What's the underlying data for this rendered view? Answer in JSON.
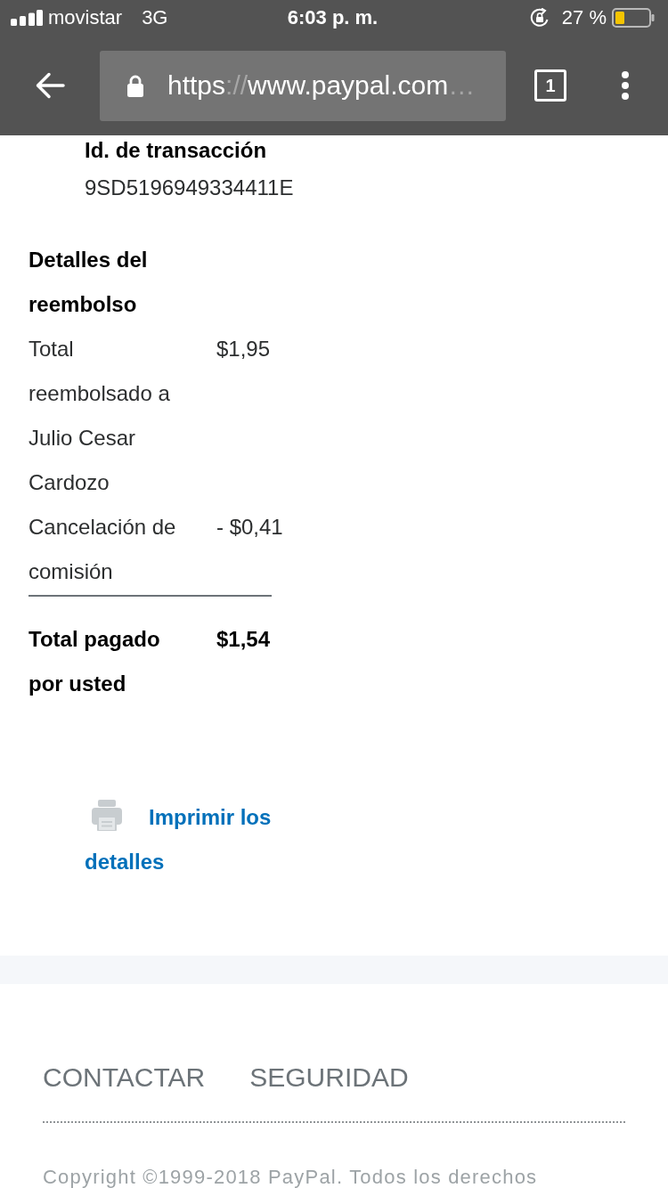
{
  "status_bar": {
    "carrier": "movistar",
    "network": "3G",
    "time": "6:03 p. m.",
    "battery": "27 %"
  },
  "browser": {
    "url": {
      "scheme": "https",
      "separator": "://",
      "host": "www.paypal.com",
      "ellipsis": "…"
    },
    "tab_count": "1"
  },
  "transaction": {
    "label": "Id. de transacción",
    "id": "9SD5196949334411E"
  },
  "refund_details": {
    "title": "Detalles del reembolso",
    "rows": [
      {
        "label": "Total reembolsado a Julio Cesar Cardozo",
        "amount": "$1,95"
      },
      {
        "label": "Cancelación de comisión",
        "amount": "- $0,41"
      }
    ],
    "total": {
      "label": "Total pagado por usted",
      "amount": "$1,54"
    }
  },
  "print_link": "Imprimir los detalles",
  "footer": {
    "links": [
      "CONTACTAR",
      "SEGURIDAD"
    ],
    "copyright": "Copyright ©1999-2018 PayPal. Todos los derechos"
  }
}
